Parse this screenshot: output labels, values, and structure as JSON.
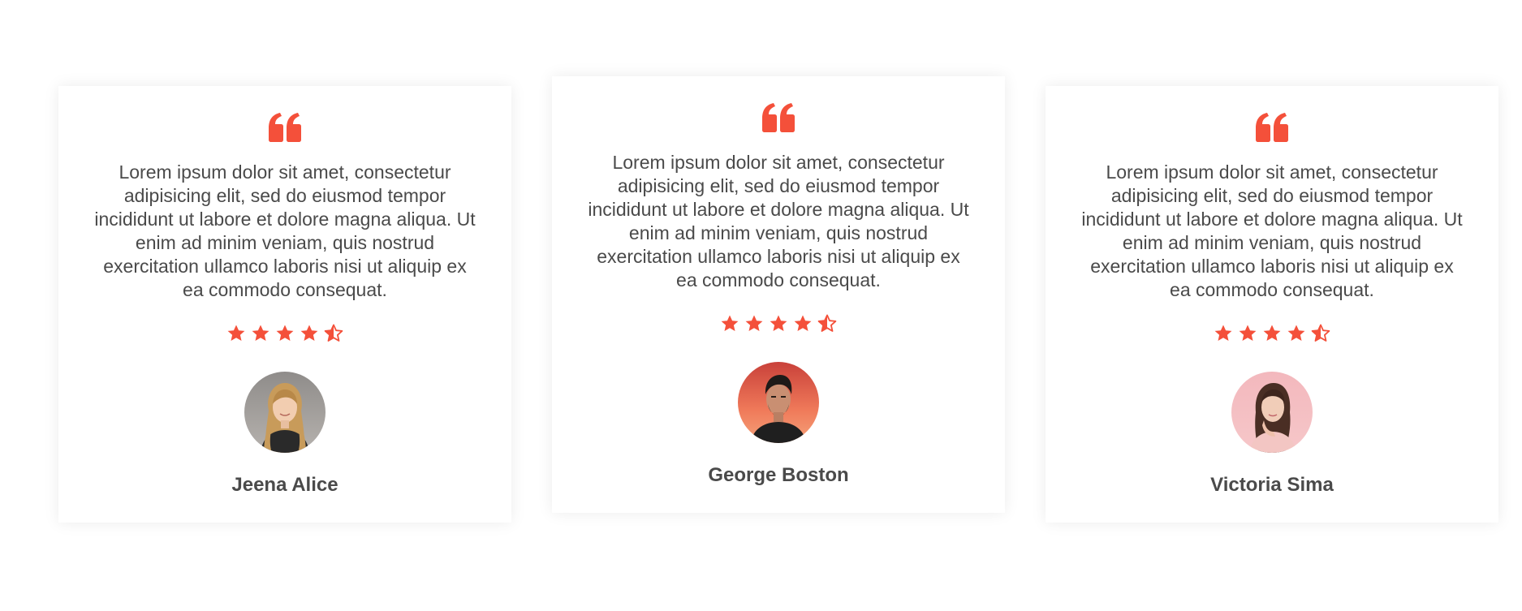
{
  "accent_color": "#f4503a",
  "text_color": "#4a4a4a",
  "testimonials": [
    {
      "quote": "Lorem ipsum dolor sit amet, consectetur adipisicing elit, sed do eiusmod tempor incididunt ut labore et dolore magna aliqua. Ut enim ad minim veniam, quis nostrud exercitation ullamco laboris nisi ut aliquip ex ea commodo consequat.",
      "rating": 4.5,
      "rating_max": 5,
      "author": "Jeena Alice",
      "avatar": "woman-blonde-portrait"
    },
    {
      "quote": "Lorem ipsum dolor sit amet, consectetur adipisicing elit, sed do eiusmod tempor incididunt ut labore et dolore magna aliqua. Ut enim ad minim veniam, quis nostrud exercitation ullamco laboris nisi ut aliquip ex ea commodo consequat.",
      "rating": 4.5,
      "rating_max": 5,
      "author": "George Boston",
      "avatar": "man-dark-hair-portrait"
    },
    {
      "quote": "Lorem ipsum dolor sit amet, consectetur adipisicing elit, sed do eiusmod tempor incididunt ut labore et dolore magna aliqua. Ut enim ad minim veniam, quis nostrud exercitation ullamco laboris nisi ut aliquip ex ea commodo consequat.",
      "rating": 4.5,
      "rating_max": 5,
      "author": "Victoria Sima",
      "avatar": "woman-brunette-portrait"
    }
  ],
  "icons": {
    "quote": "quote-icon",
    "star_full": "star-icon",
    "star_half": "star-half-icon"
  }
}
